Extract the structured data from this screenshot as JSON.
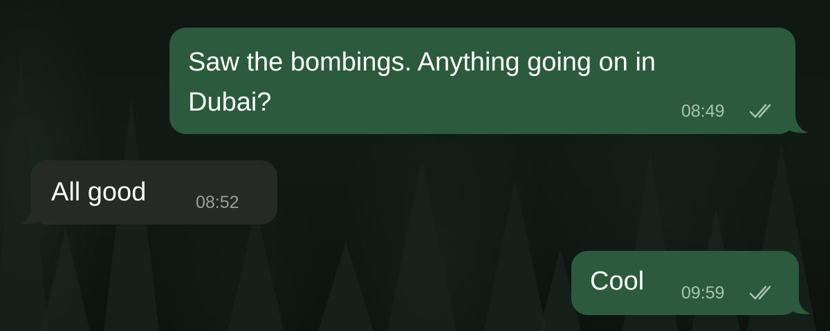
{
  "chat": {
    "messages": [
      {
        "direction": "outgoing",
        "lines": [
          "Saw the bombings. Anything going on in",
          "Dubai?"
        ],
        "time": "08:49",
        "status": "double-check-read-icon"
      },
      {
        "direction": "incoming",
        "text": "All good",
        "time": "08:52"
      },
      {
        "direction": "outgoing",
        "text": "Cool",
        "time": "09:59",
        "status": "double-check-read-icon"
      }
    ]
  },
  "colors": {
    "outgoing_bubble": "#2b5a3c",
    "incoming_bubble": "#262a27",
    "background": "#111a14",
    "message_text": "#ffffff",
    "outgoing_time": "#a9c4b2"
  }
}
